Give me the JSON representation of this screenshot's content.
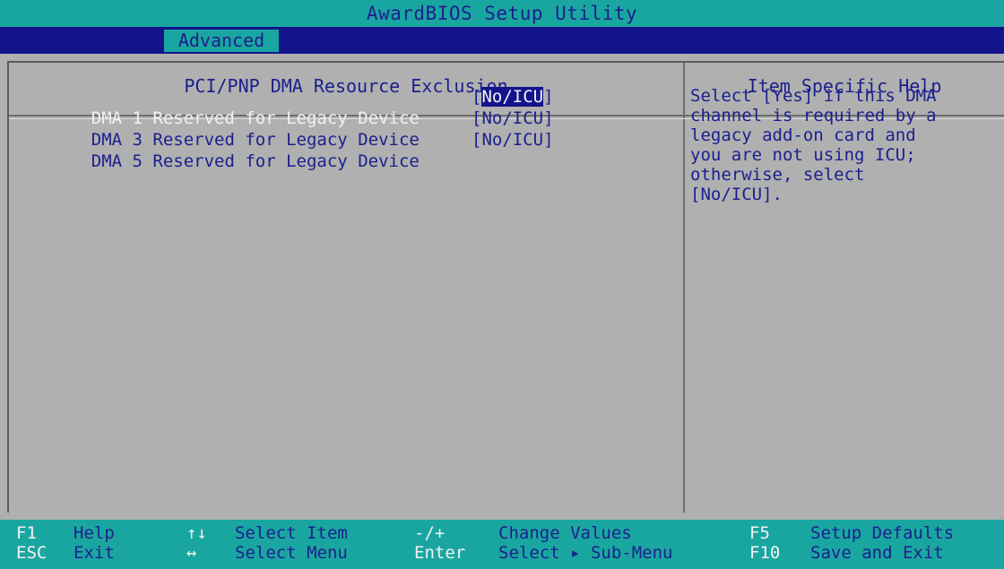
{
  "title": "AwardBIOS Setup Utility",
  "menu": {
    "active_tab": "Advanced"
  },
  "panel": {
    "header": "PCI/PNP DMA Resource Exclusion",
    "settings": [
      {
        "prefix": "DMA",
        "label": " 1 Reserved for Legacy Device",
        "open": "[",
        "value": "No/ICU",
        "close": "]"
      },
      {
        "prefix": "DMA",
        "label": " 3 Reserved for Legacy Device",
        "open": "[",
        "value": "No/ICU",
        "close": "]"
      },
      {
        "prefix": "DMA",
        "label": " 5 Reserved for Legacy Device",
        "open": "[",
        "value": "No/ICU",
        "close": "]"
      }
    ]
  },
  "help": {
    "header": "Item Specific Help",
    "text": "Select [Yes] if this DMA\nchannel is required by a\nlegacy add-on card and\nyou are not using ICU;\notherwise, select\n[No/ICU]."
  },
  "footer": {
    "keys": [
      {
        "key": "F1",
        "desc": "Help"
      },
      {
        "key": "ESC",
        "desc": "Exit"
      },
      {
        "key": "↑↓",
        "desc": "Select Item"
      },
      {
        "key": "↔",
        "desc": "Select Menu"
      },
      {
        "key": "-/+",
        "desc": "Change Values"
      },
      {
        "key": "Enter",
        "desc": "Select ▸ Sub-Menu"
      },
      {
        "key": "F5",
        "desc": "Setup Defaults"
      },
      {
        "key": "F10",
        "desc": "Save and Exit"
      }
    ]
  },
  "colors": {
    "teal": "#1aa6a0",
    "navy": "#13138c",
    "text_blue": "#1b1f8e",
    "panel_gray": "#b0b0b0",
    "highlight_white": "#f2f2f2"
  }
}
